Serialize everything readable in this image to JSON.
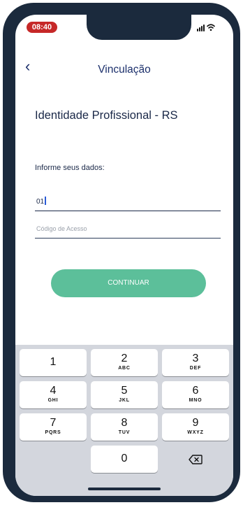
{
  "status_bar": {
    "time": "08:40",
    "signal": "signal-icon",
    "wifi": "wifi-icon"
  },
  "nav": {
    "back_icon": "chevron-left-icon",
    "back_glyph": "‹",
    "title": "Vinculação"
  },
  "heading": "Identidade Profissional - RS",
  "form": {
    "label": "Informe seus dados:",
    "field1_value": "01",
    "field2_placeholder": "Código de Acesso",
    "button_label": "CONTINUAR"
  },
  "keyboard": {
    "keys": [
      {
        "digit": "1",
        "letters": ""
      },
      {
        "digit": "2",
        "letters": "ABC"
      },
      {
        "digit": "3",
        "letters": "DEF"
      },
      {
        "digit": "4",
        "letters": "GHI"
      },
      {
        "digit": "5",
        "letters": "JKL"
      },
      {
        "digit": "6",
        "letters": "MNO"
      },
      {
        "digit": "7",
        "letters": "PQRS"
      },
      {
        "digit": "8",
        "letters": "TUV"
      },
      {
        "digit": "9",
        "letters": "WXYZ"
      },
      {
        "digit": "0",
        "letters": ""
      }
    ],
    "delete_icon": "backspace-icon"
  },
  "colors": {
    "frame": "#1b2a3d",
    "primary_text": "#1b2f6b",
    "button": "#5cbf9a",
    "time_badge": "#c62828",
    "keyboard_bg": "#d3d6dd"
  }
}
